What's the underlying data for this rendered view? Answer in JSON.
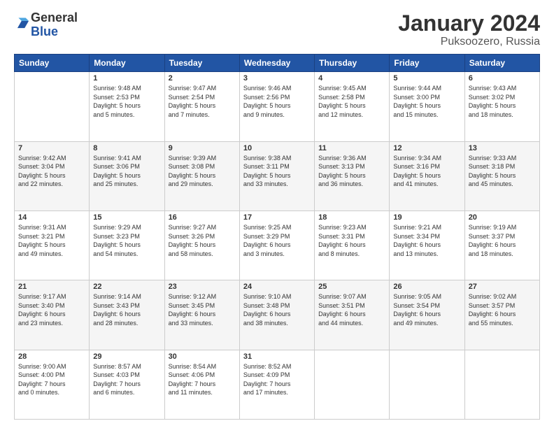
{
  "header": {
    "logo_general": "General",
    "logo_blue": "Blue",
    "month": "January 2024",
    "location": "Puksoozero, Russia"
  },
  "weekdays": [
    "Sunday",
    "Monday",
    "Tuesday",
    "Wednesday",
    "Thursday",
    "Friday",
    "Saturday"
  ],
  "weeks": [
    [
      {
        "day": "",
        "info": ""
      },
      {
        "day": "1",
        "info": "Sunrise: 9:48 AM\nSunset: 2:53 PM\nDaylight: 5 hours\nand 5 minutes."
      },
      {
        "day": "2",
        "info": "Sunrise: 9:47 AM\nSunset: 2:54 PM\nDaylight: 5 hours\nand 7 minutes."
      },
      {
        "day": "3",
        "info": "Sunrise: 9:46 AM\nSunset: 2:56 PM\nDaylight: 5 hours\nand 9 minutes."
      },
      {
        "day": "4",
        "info": "Sunrise: 9:45 AM\nSunset: 2:58 PM\nDaylight: 5 hours\nand 12 minutes."
      },
      {
        "day": "5",
        "info": "Sunrise: 9:44 AM\nSunset: 3:00 PM\nDaylight: 5 hours\nand 15 minutes."
      },
      {
        "day": "6",
        "info": "Sunrise: 9:43 AM\nSunset: 3:02 PM\nDaylight: 5 hours\nand 18 minutes."
      }
    ],
    [
      {
        "day": "7",
        "info": "Sunrise: 9:42 AM\nSunset: 3:04 PM\nDaylight: 5 hours\nand 22 minutes."
      },
      {
        "day": "8",
        "info": "Sunrise: 9:41 AM\nSunset: 3:06 PM\nDaylight: 5 hours\nand 25 minutes."
      },
      {
        "day": "9",
        "info": "Sunrise: 9:39 AM\nSunset: 3:08 PM\nDaylight: 5 hours\nand 29 minutes."
      },
      {
        "day": "10",
        "info": "Sunrise: 9:38 AM\nSunset: 3:11 PM\nDaylight: 5 hours\nand 33 minutes."
      },
      {
        "day": "11",
        "info": "Sunrise: 9:36 AM\nSunset: 3:13 PM\nDaylight: 5 hours\nand 36 minutes."
      },
      {
        "day": "12",
        "info": "Sunrise: 9:34 AM\nSunset: 3:16 PM\nDaylight: 5 hours\nand 41 minutes."
      },
      {
        "day": "13",
        "info": "Sunrise: 9:33 AM\nSunset: 3:18 PM\nDaylight: 5 hours\nand 45 minutes."
      }
    ],
    [
      {
        "day": "14",
        "info": "Sunrise: 9:31 AM\nSunset: 3:21 PM\nDaylight: 5 hours\nand 49 minutes."
      },
      {
        "day": "15",
        "info": "Sunrise: 9:29 AM\nSunset: 3:23 PM\nDaylight: 5 hours\nand 54 minutes."
      },
      {
        "day": "16",
        "info": "Sunrise: 9:27 AM\nSunset: 3:26 PM\nDaylight: 5 hours\nand 58 minutes."
      },
      {
        "day": "17",
        "info": "Sunrise: 9:25 AM\nSunset: 3:29 PM\nDaylight: 6 hours\nand 3 minutes."
      },
      {
        "day": "18",
        "info": "Sunrise: 9:23 AM\nSunset: 3:31 PM\nDaylight: 6 hours\nand 8 minutes."
      },
      {
        "day": "19",
        "info": "Sunrise: 9:21 AM\nSunset: 3:34 PM\nDaylight: 6 hours\nand 13 minutes."
      },
      {
        "day": "20",
        "info": "Sunrise: 9:19 AM\nSunset: 3:37 PM\nDaylight: 6 hours\nand 18 minutes."
      }
    ],
    [
      {
        "day": "21",
        "info": "Sunrise: 9:17 AM\nSunset: 3:40 PM\nDaylight: 6 hours\nand 23 minutes."
      },
      {
        "day": "22",
        "info": "Sunrise: 9:14 AM\nSunset: 3:43 PM\nDaylight: 6 hours\nand 28 minutes."
      },
      {
        "day": "23",
        "info": "Sunrise: 9:12 AM\nSunset: 3:45 PM\nDaylight: 6 hours\nand 33 minutes."
      },
      {
        "day": "24",
        "info": "Sunrise: 9:10 AM\nSunset: 3:48 PM\nDaylight: 6 hours\nand 38 minutes."
      },
      {
        "day": "25",
        "info": "Sunrise: 9:07 AM\nSunset: 3:51 PM\nDaylight: 6 hours\nand 44 minutes."
      },
      {
        "day": "26",
        "info": "Sunrise: 9:05 AM\nSunset: 3:54 PM\nDaylight: 6 hours\nand 49 minutes."
      },
      {
        "day": "27",
        "info": "Sunrise: 9:02 AM\nSunset: 3:57 PM\nDaylight: 6 hours\nand 55 minutes."
      }
    ],
    [
      {
        "day": "28",
        "info": "Sunrise: 9:00 AM\nSunset: 4:00 PM\nDaylight: 7 hours\nand 0 minutes."
      },
      {
        "day": "29",
        "info": "Sunrise: 8:57 AM\nSunset: 4:03 PM\nDaylight: 7 hours\nand 6 minutes."
      },
      {
        "day": "30",
        "info": "Sunrise: 8:54 AM\nSunset: 4:06 PM\nDaylight: 7 hours\nand 11 minutes."
      },
      {
        "day": "31",
        "info": "Sunrise: 8:52 AM\nSunset: 4:09 PM\nDaylight: 7 hours\nand 17 minutes."
      },
      {
        "day": "",
        "info": ""
      },
      {
        "day": "",
        "info": ""
      },
      {
        "day": "",
        "info": ""
      }
    ]
  ]
}
